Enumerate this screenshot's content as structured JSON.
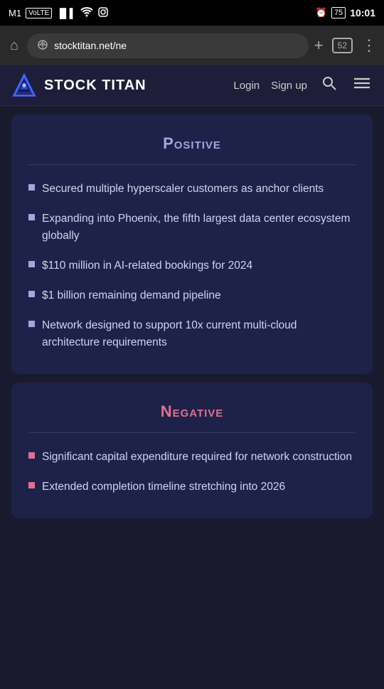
{
  "statusBar": {
    "carrier": "M1",
    "volte": "VoLTE",
    "signal": "signal",
    "wifi": "wifi",
    "instagram": "instagram",
    "alarm": "alarm",
    "battery": "75",
    "time": "10:01"
  },
  "browser": {
    "addressText": "stocktitan.net/ne",
    "tabCount": "52",
    "plusLabel": "+",
    "menuLabel": "⋮",
    "homeLabel": "⌂"
  },
  "navbar": {
    "logoText": "STOCK TITAN",
    "loginLabel": "Login",
    "signupLabel": "Sign up"
  },
  "positive": {
    "title": "Positive",
    "bullets": [
      "Secured multiple hyperscaler customers as anchor clients",
      "Expanding into Phoenix, the fifth largest data center ecosystem globally",
      "$110 million in AI-related bookings for 2024",
      "$1 billion remaining demand pipeline",
      "Network designed to support 10x current multi-cloud architecture requirements"
    ]
  },
  "negative": {
    "title": "Negative",
    "bullets": [
      "Significant capital expenditure required for network construction",
      "Extended completion timeline stretching into 2026"
    ]
  }
}
